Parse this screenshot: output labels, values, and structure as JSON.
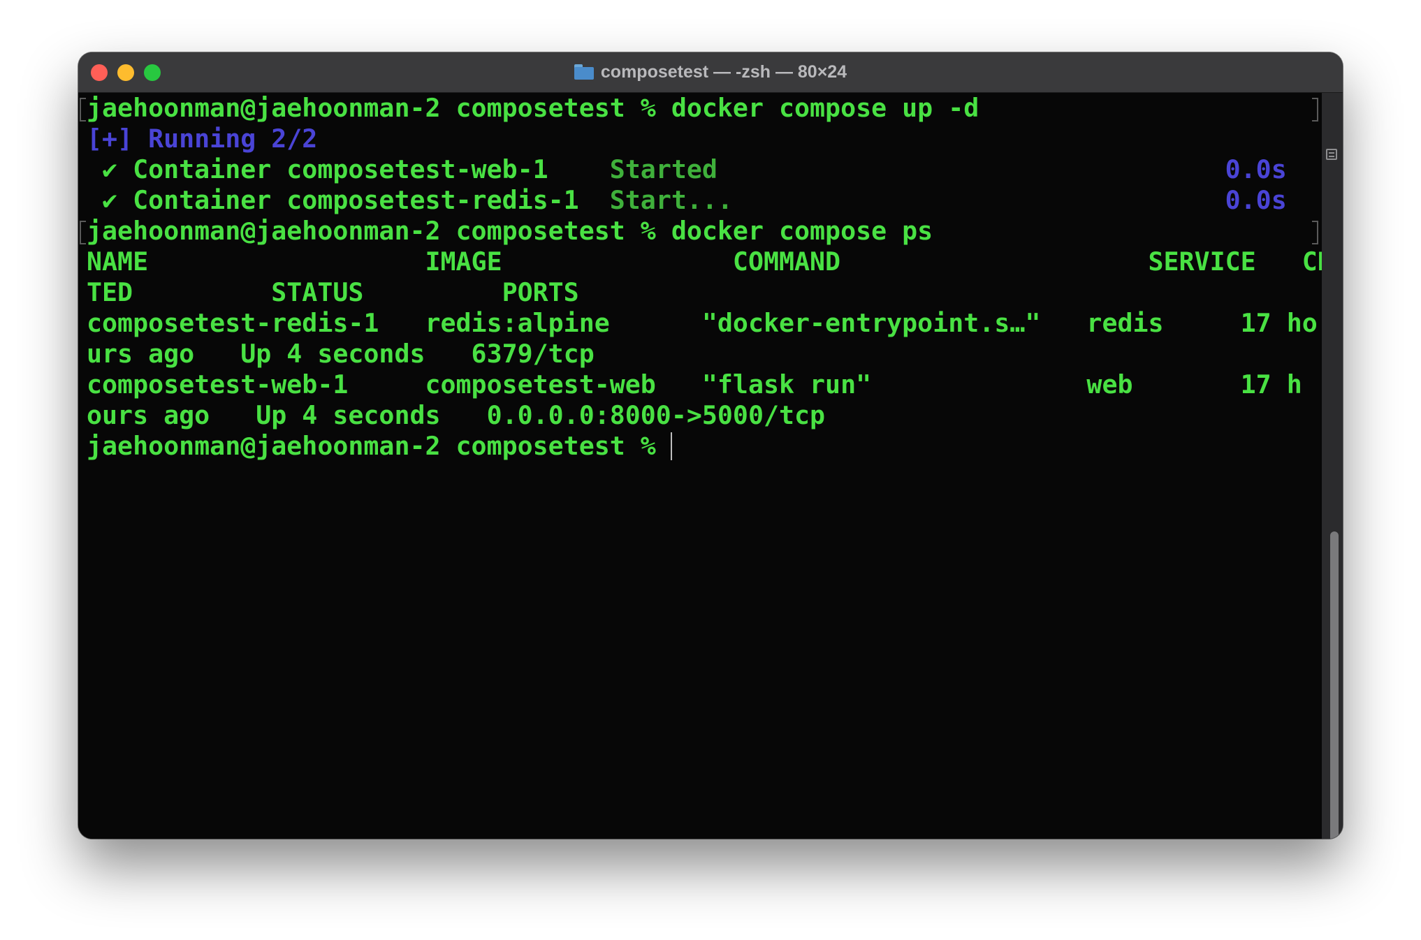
{
  "window": {
    "title": "composetest — -zsh — 80×24",
    "icon": "folder-icon"
  },
  "terminal": {
    "lines": [
      {
        "segments": [
          {
            "text": "jaehoonman@jaehoonman-2 composetest % docker compose up -d",
            "color": "#49e143"
          }
        ],
        "marked": true
      },
      {
        "segments": [
          {
            "text": "[+] Running 2/2",
            "color": "#4a44d6"
          }
        ]
      },
      {
        "segments": [
          {
            "text": " ✔ Container composetest-web-1    ",
            "color": "#49e143"
          },
          {
            "text": "Started",
            "color": "#3fb03b"
          },
          {
            "text": "                                 ",
            "color": "#49e143"
          },
          {
            "text": "0.0s",
            "color": "#4a44d6"
          }
        ]
      },
      {
        "segments": [
          {
            "text": " ✔ Container composetest-redis-1  ",
            "color": "#49e143"
          },
          {
            "text": "Start...",
            "color": "#3fb03b"
          },
          {
            "text": "                                ",
            "color": "#49e143"
          },
          {
            "text": "0.0s",
            "color": "#4a44d6"
          }
        ]
      },
      {
        "segments": [
          {
            "text": "jaehoonman@jaehoonman-2 composetest % docker compose ps",
            "color": "#49e143"
          }
        ],
        "marked": true
      },
      {
        "segments": [
          {
            "text": "NAME                  IMAGE               COMMAND                    SERVICE   CREA",
            "color": "#49e143"
          }
        ]
      },
      {
        "segments": [
          {
            "text": "TED         STATUS         PORTS",
            "color": "#49e143"
          }
        ]
      },
      {
        "segments": [
          {
            "text": "composetest-redis-1   redis:alpine      \"docker-entrypoint.s…\"   redis     17 ho",
            "color": "#49e143"
          }
        ]
      },
      {
        "segments": [
          {
            "text": "urs ago   Up 4 seconds   6379/tcp",
            "color": "#49e143"
          }
        ]
      },
      {
        "segments": [
          {
            "text": "composetest-web-1     composetest-web   \"flask run\"              web       17 h",
            "color": "#49e143"
          }
        ]
      },
      {
        "segments": [
          {
            "text": "ours ago   Up 4 seconds   0.0.0.0:8000->5000/tcp",
            "color": "#49e143"
          }
        ]
      },
      {
        "segments": [
          {
            "text": "jaehoonman@jaehoonman-2 composetest % ",
            "color": "#49e143"
          }
        ]
      }
    ]
  }
}
